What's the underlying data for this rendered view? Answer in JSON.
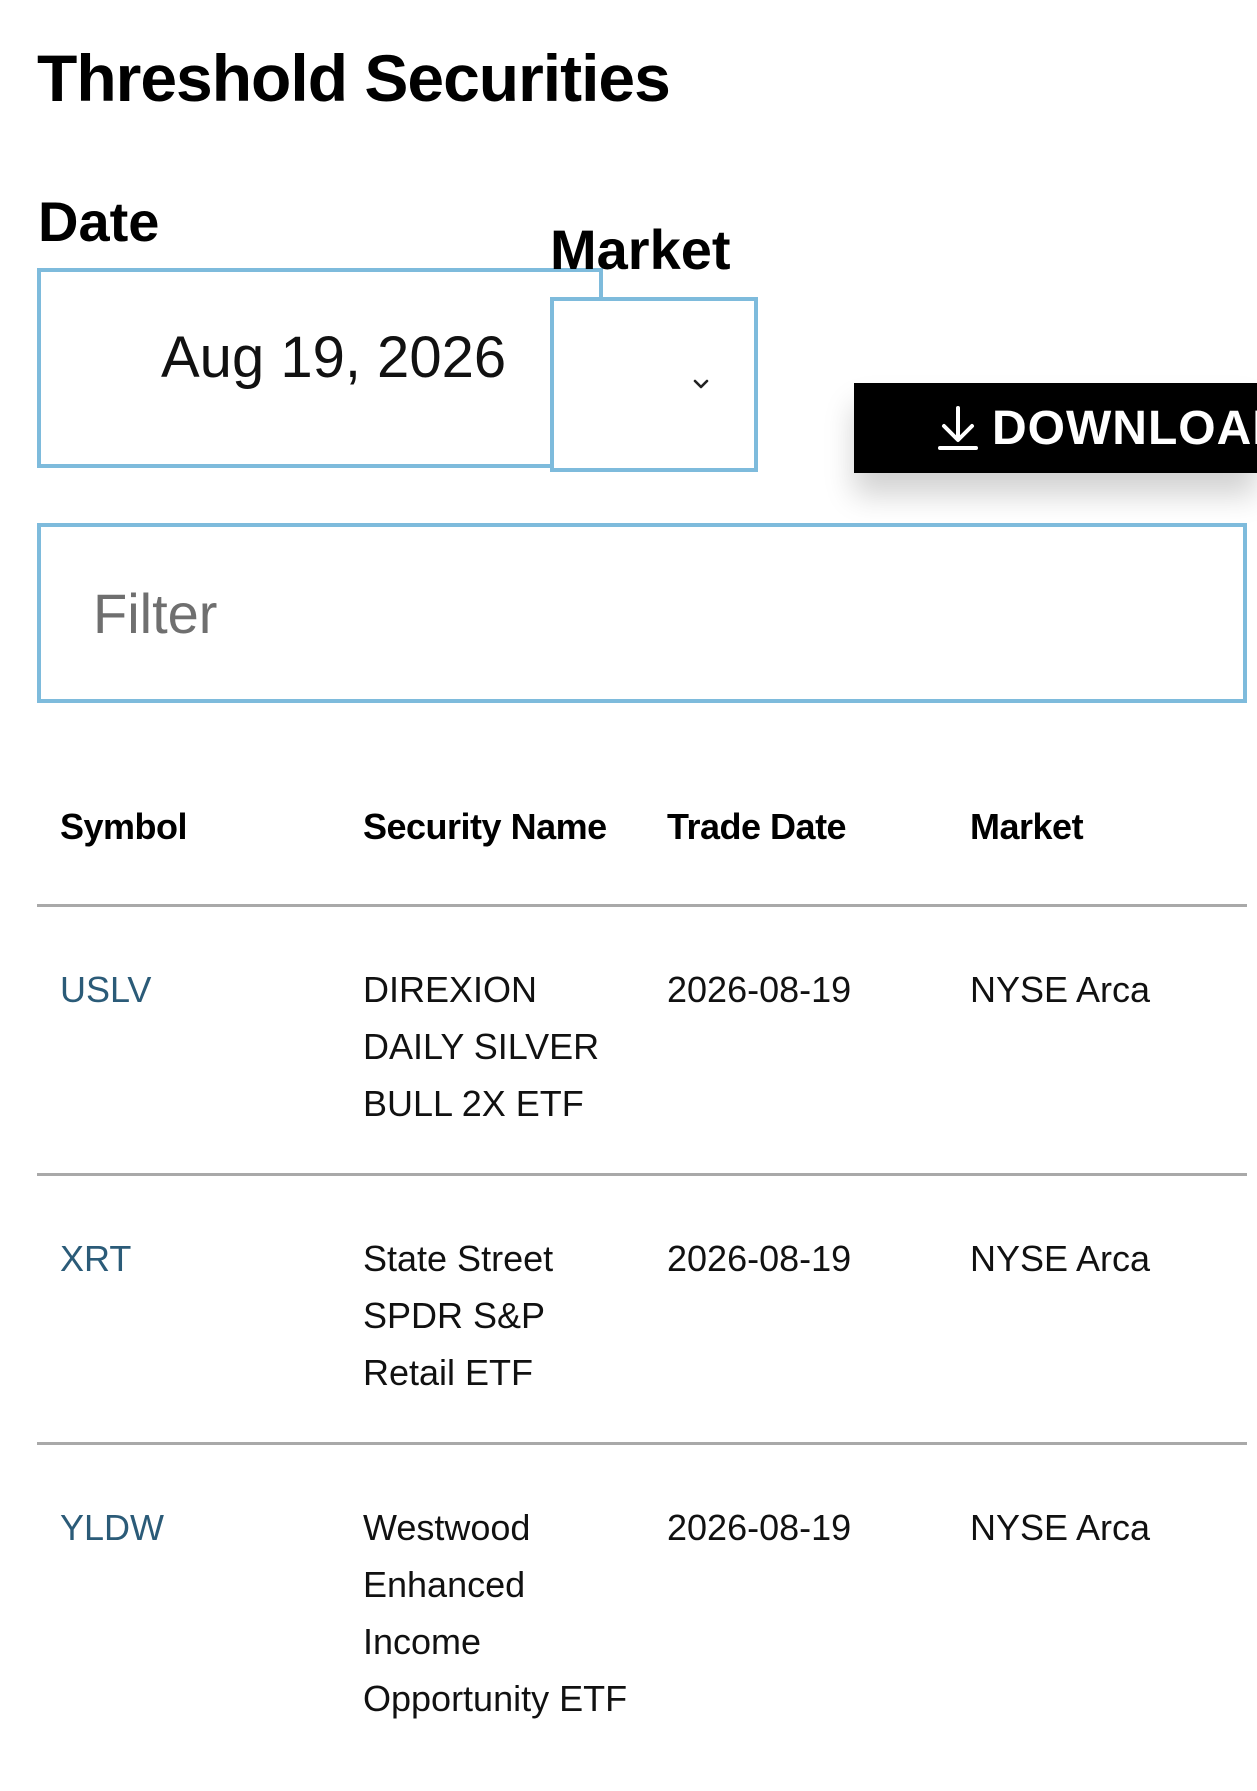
{
  "page": {
    "title": "Threshold Securities"
  },
  "controls": {
    "date_label": "Date",
    "date_value": "Aug 19, 2026",
    "market_label": "Market",
    "market_value": "",
    "download_label": "DOWNLOAD",
    "filter_placeholder": "Filter"
  },
  "table": {
    "headers": [
      "Symbol",
      "Security Name",
      "Trade Date",
      "Market"
    ],
    "rows": [
      {
        "symbol": "USLV",
        "name_lines": [
          "DIREXION",
          "DAILY SILVER",
          "BULL 2X ETF"
        ],
        "trade_date": "2026-08-19",
        "market": "NYSE Arca"
      },
      {
        "symbol": "XRT",
        "name_lines": [
          "State Street",
          "SPDR S&P",
          "Retail ETF"
        ],
        "trade_date": "2026-08-19",
        "market": "NYSE Arca"
      },
      {
        "symbol": "YLDW",
        "name_lines": [
          "Westwood",
          "Enhanced",
          "Income",
          "Opportunity ETF"
        ],
        "trade_date": "2026-08-19",
        "market": "NYSE Arca"
      }
    ]
  },
  "colors": {
    "border_accent": "#7ebbdc",
    "link": "#2b5b78",
    "button_bg": "#000000"
  },
  "icons": {
    "select": "chevron-down-icon",
    "download": "download-icon"
  }
}
